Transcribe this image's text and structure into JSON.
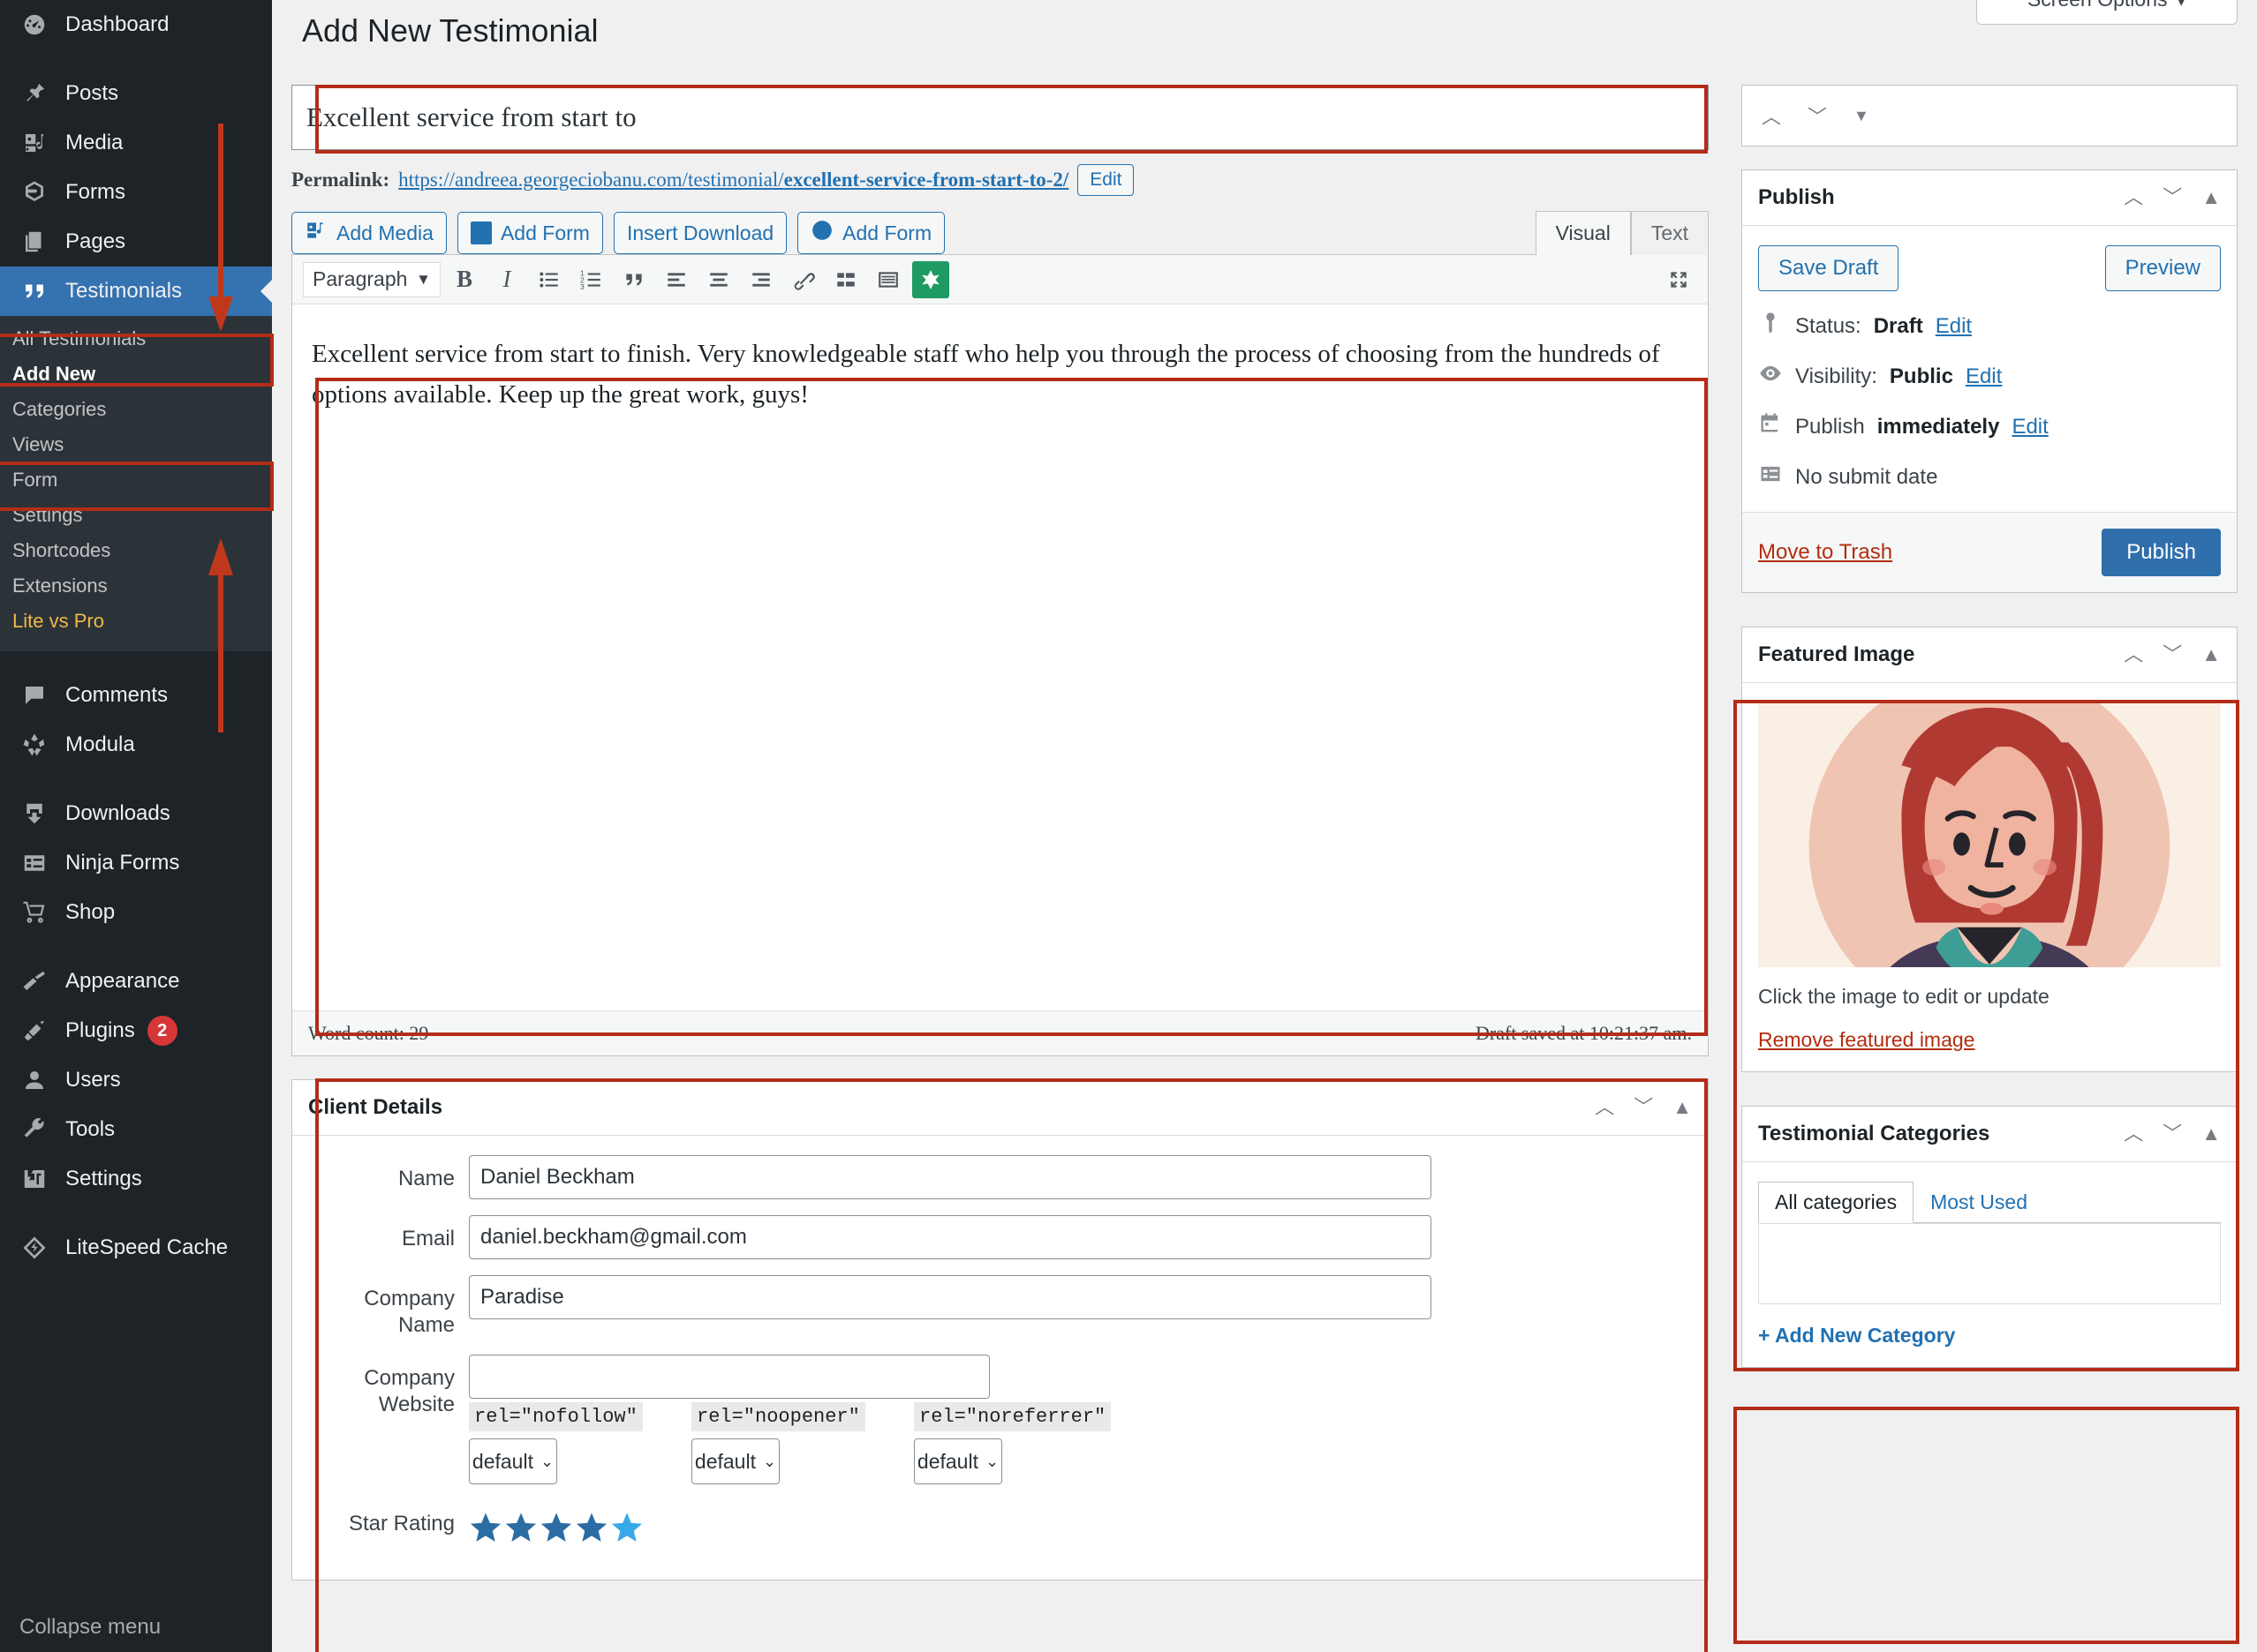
{
  "sidebar": {
    "items": [
      {
        "label": "Dashboard",
        "icon": "dashboard-icon"
      },
      {
        "label": "Posts",
        "icon": "pin-icon",
        "sep": true
      },
      {
        "label": "Media",
        "icon": "media-icon"
      },
      {
        "label": "Forms",
        "icon": "forms-icon"
      },
      {
        "label": "Pages",
        "icon": "pages-icon"
      },
      {
        "label": "Testimonials",
        "icon": "quote-icon",
        "current": true
      }
    ],
    "submenu": [
      {
        "label": "All Testimonials"
      },
      {
        "label": "Add New",
        "current": true
      },
      {
        "label": "Categories"
      },
      {
        "label": "Views"
      },
      {
        "label": "Form"
      },
      {
        "label": "Settings"
      },
      {
        "label": "Shortcodes"
      },
      {
        "label": "Extensions"
      },
      {
        "label": "Lite vs Pro",
        "promo": true
      }
    ],
    "items2": [
      {
        "label": "Comments",
        "icon": "comment-icon",
        "sep": true
      },
      {
        "label": "Modula",
        "icon": "modula-icon"
      },
      {
        "label": "Downloads",
        "icon": "download-icon",
        "sep": true
      },
      {
        "label": "Ninja Forms",
        "icon": "ninja-forms-icon"
      },
      {
        "label": "Shop",
        "icon": "cart-icon"
      },
      {
        "label": "Appearance",
        "icon": "brush-icon",
        "sep": true
      },
      {
        "label": "Plugins",
        "icon": "plugin-icon",
        "badge": "2"
      },
      {
        "label": "Users",
        "icon": "user-icon"
      },
      {
        "label": "Tools",
        "icon": "wrench-icon"
      },
      {
        "label": "Settings",
        "icon": "settings-icon"
      },
      {
        "label": "LiteSpeed Cache",
        "icon": "litespeed-icon",
        "sep": true
      }
    ],
    "collapse_label": "Collapse menu"
  },
  "header": {
    "page_title": "Add New Testimonial",
    "screen_options_label": "Screen Options"
  },
  "post": {
    "title_value": "Excellent service from start to",
    "permalink_label": "Permalink:",
    "permalink_base": "https://andreea.georgeciobanu.com/testimonial/",
    "permalink_slug": "excellent-service-from-start-to-2/",
    "permalink_edit_label": "Edit"
  },
  "media_buttons": [
    {
      "label": "Add Media",
      "icon": "add-media-icon"
    },
    {
      "label": "Add Form",
      "icon": "add-form-icon"
    },
    {
      "label": "Insert Download",
      "icon": "insert-download-icon"
    },
    {
      "label": "Add Form",
      "icon": "add-form-edd-icon"
    }
  ],
  "editor": {
    "tab_visual": "Visual",
    "tab_text": "Text",
    "format_select": "Paragraph",
    "content": "Excellent service from start to finish. Very knowledgeable staff who help you through the process of choosing from the hundreds of options available. Keep up the great work, guys!",
    "word_count": "Word count: 29",
    "draft_saved": "Draft saved at 10:21:37 am."
  },
  "client_details": {
    "title": "Client Details",
    "name_label": "Name",
    "name_value": "Daniel Beckham",
    "email_label": "Email",
    "email_value": "daniel.beckham@gmail.com",
    "company_name_label": "Company Name",
    "company_name_value": "Paradise",
    "company_website_label": "Company Website",
    "company_website_value": "",
    "rel_options": [
      {
        "tag": "rel=\"nofollow\"",
        "value": "default"
      },
      {
        "tag": "rel=\"noopener\"",
        "value": "default"
      },
      {
        "tag": "rel=\"noreferrer\"",
        "value": "default"
      }
    ],
    "star_label": "Star Rating",
    "star_rating": 5,
    "star_color": "#2b6ca3",
    "star_color_last": "#38a9e8"
  },
  "publish": {
    "title": "Publish",
    "save_draft": "Save Draft",
    "preview": "Preview",
    "status_prefix": "Status:",
    "status_value": "Draft",
    "status_edit": "Edit",
    "visibility_prefix": "Visibility:",
    "visibility_value": "Public",
    "visibility_edit": "Edit",
    "schedule_prefix": "Publish",
    "schedule_value": "immediately",
    "schedule_edit": "Edit",
    "submit_date": "No submit date",
    "trash": "Move to Trash",
    "publish": "Publish",
    "publish_color": "#2f6fab"
  },
  "featured_image": {
    "title": "Featured Image",
    "caption": "Click the image to edit or update",
    "remove": "Remove featured image"
  },
  "categories": {
    "title": "Testimonial Categories",
    "tab_all": "All categories",
    "tab_most": "Most Used",
    "add_new": "+ Add New Category"
  }
}
